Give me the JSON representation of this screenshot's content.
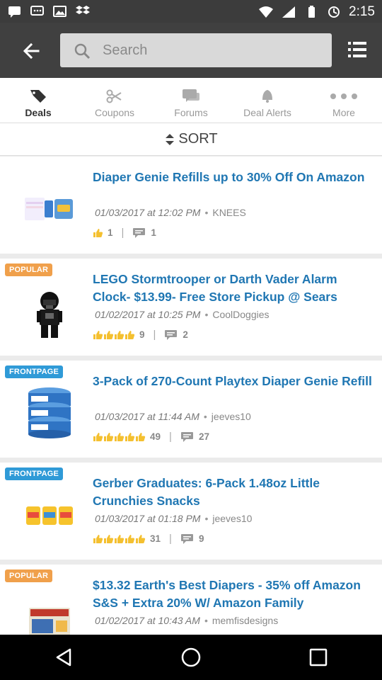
{
  "status_bar": {
    "time": "2:15",
    "icons": [
      "message-icon",
      "sms-icon",
      "photo-icon",
      "dropbox-icon",
      "wifi-icon",
      "signal-icon",
      "battery-icon",
      "sync-icon"
    ]
  },
  "toolbar": {
    "back_icon": "arrow-left-icon",
    "search_placeholder": "Search",
    "menu_icon": "list-menu-icon"
  },
  "tabs": [
    {
      "label": "Deals",
      "icon": "tag-icon",
      "active": true
    },
    {
      "label": "Coupons",
      "icon": "scissors-icon",
      "active": false
    },
    {
      "label": "Forums",
      "icon": "chat-icon",
      "active": false
    },
    {
      "label": "Deal Alerts",
      "icon": "bell-icon",
      "active": false
    },
    {
      "label": "More",
      "icon": "more-dots-icon",
      "active": false
    }
  ],
  "sort_label": "SORT",
  "deals": [
    {
      "badge": "",
      "title": "Diaper Genie Refills up to 30% Off On Amazon",
      "date": "01/03/2017 at 12:02 PM",
      "author": "KNEES",
      "likes": "1",
      "thumbs_count": 1,
      "comments": "1",
      "image": "diaper-genie-refills-image"
    },
    {
      "badge": "POPULAR",
      "title": "LEGO Stormtrooper or Darth Vader Alarm Clock- $13.99- Free Store Pickup @ Sears",
      "date": "01/02/2017 at 10:25 PM",
      "author": "CoolDoggies",
      "likes": "9",
      "thumbs_count": 4,
      "comments": "2",
      "image": "lego-darth-vader-clock-image"
    },
    {
      "badge": "FRONTPAGE",
      "title": "3-Pack of 270-Count Playtex Diaper Genie Refill",
      "date": "01/03/2017 at 11:44 AM",
      "author": "jeeves10",
      "likes": "49",
      "thumbs_count": 5,
      "comments": "27",
      "image": "playtex-refill-pack-image"
    },
    {
      "badge": "FRONTPAGE",
      "title": "Gerber Graduates: 6-Pack 1.48oz Little Crunchies Snacks",
      "date": "01/03/2017 at 01:18 PM",
      "author": "jeeves10",
      "likes": "31",
      "thumbs_count": 5,
      "comments": "9",
      "image": "gerber-crunchies-image"
    },
    {
      "badge": "POPULAR",
      "title": "$13.32 Earth's Best Diapers - 35% off Amazon S&S + Extra 20% W/ Amazon Family",
      "date": "01/02/2017 at 10:43 AM",
      "author": "memfisdesigns",
      "likes": "",
      "thumbs_count": 0,
      "comments": "",
      "image": "earths-best-diapers-image"
    }
  ],
  "nav": {
    "back": "nav-back-icon",
    "home": "nav-home-icon",
    "recents": "nav-recents-icon"
  }
}
